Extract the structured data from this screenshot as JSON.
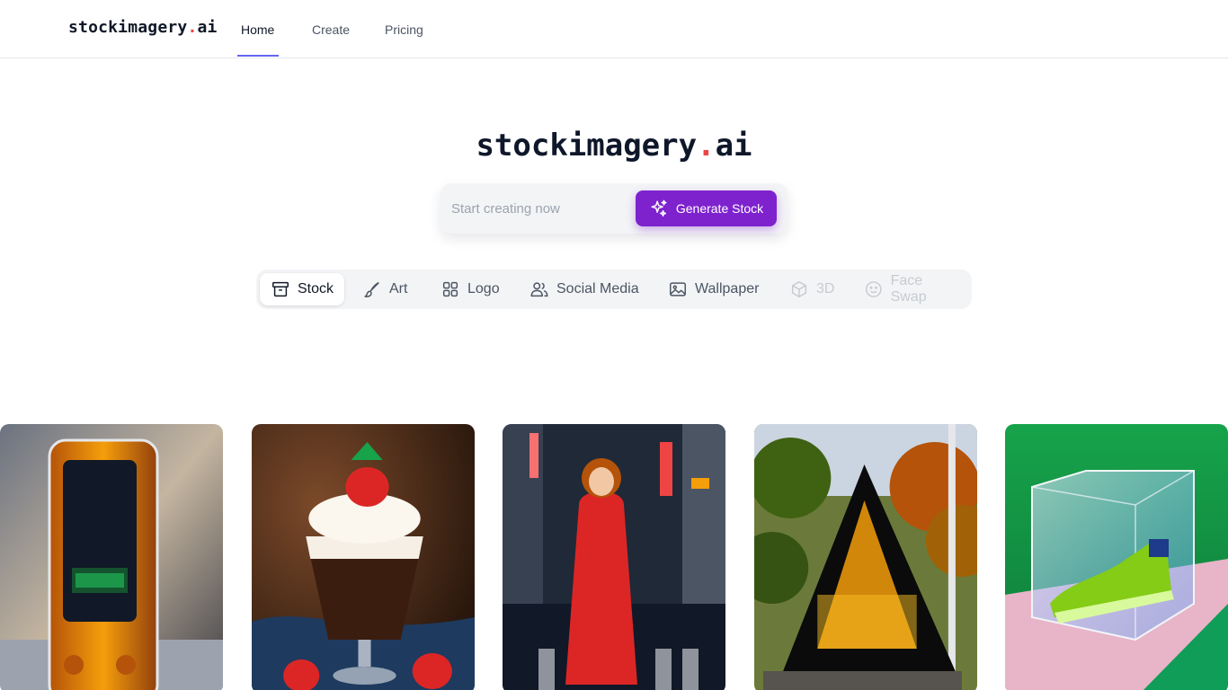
{
  "brand": {
    "name": "stockimagery",
    "dot": ".",
    "tld": "ai"
  },
  "nav": {
    "home": "Home",
    "create": "Create",
    "pricing": "Pricing"
  },
  "hero": {
    "title_name": "stockimagery",
    "title_dot": ".",
    "title_tld": "ai"
  },
  "search": {
    "placeholder": "Start creating now",
    "value": "",
    "button_label": "Generate Stock",
    "button_icon": "sparkles-icon"
  },
  "categories": [
    {
      "label": "Stock",
      "icon": "archive-box-icon",
      "state": "active"
    },
    {
      "label": "Art",
      "icon": "paintbrush-icon",
      "state": "enabled"
    },
    {
      "label": "Logo",
      "icon": "grid-icon",
      "state": "enabled"
    },
    {
      "label": "Social Media",
      "icon": "users-icon",
      "state": "enabled"
    },
    {
      "label": "Wallpaper",
      "icon": "image-icon",
      "state": "enabled"
    },
    {
      "label": "3D",
      "icon": "cube-icon",
      "state": "disabled"
    },
    {
      "label": "Face Swap",
      "icon": "smiley-icon",
      "state": "disabled"
    }
  ],
  "gallery": [
    {
      "subject": "transparent-orange-phone"
    },
    {
      "subject": "chocolate-sundae-strawberry"
    },
    {
      "subject": "woman-red-raincoat-city-street"
    },
    {
      "subject": "a-frame-cabin-forest"
    },
    {
      "subject": "green-sneaker-glass-cube"
    }
  ],
  "colors": {
    "accent": "#7e22ce",
    "nav_underline": "#6366f1",
    "brand_dot": "#ef4444"
  }
}
